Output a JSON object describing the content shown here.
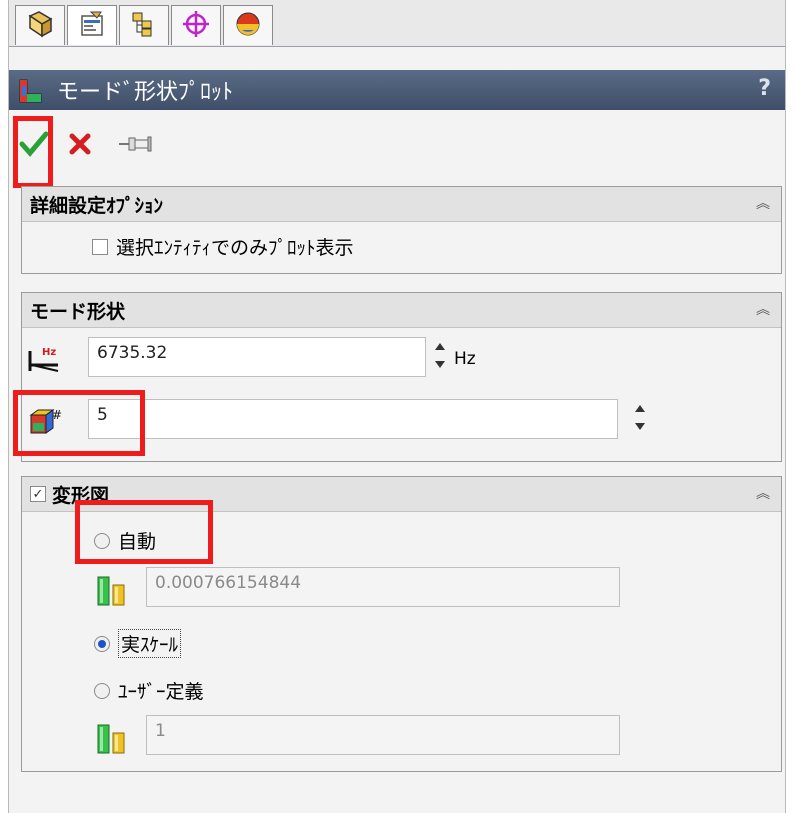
{
  "tabs": [
    {
      "icon": "feature-manager-icon"
    },
    {
      "icon": "property-manager-icon"
    },
    {
      "icon": "configuration-manager-icon"
    },
    {
      "icon": "dimxpert-icon"
    },
    {
      "icon": "display-manager-icon"
    }
  ],
  "title": "モードﾞ形状ﾌﾟﾛｯﾄ",
  "help": "?",
  "actions": {
    "ok_icon": "check-icon",
    "cancel_icon": "close-icon",
    "pin_icon": "pin-icon"
  },
  "advanced": {
    "title": "詳細設定ｵﾌﾟｼｮﾝ",
    "selected_only_label": "選択ｴﾝﾃｨﾃｨでのみﾌﾟﾛｯﾄ表示",
    "selected_only_checked": false
  },
  "mode_shape": {
    "title": "モード形状",
    "frequency_value": "6735.32",
    "frequency_unit": "Hz",
    "mode_number": "5"
  },
  "deformed": {
    "title": "変形図",
    "checked": "✓",
    "auto_label": "自動",
    "auto_scale_value": "0.000766154844",
    "true_scale_label": "実ｽｹｰﾙ",
    "user_defined_label": "ﾕｰｻﾞｰ定義",
    "user_scale_value": "1",
    "selected": "true_scale"
  },
  "colors": {
    "title_bar": "#4a5a76",
    "highlight": "#ee1c1c",
    "radio_selected": "#1a55c8"
  }
}
